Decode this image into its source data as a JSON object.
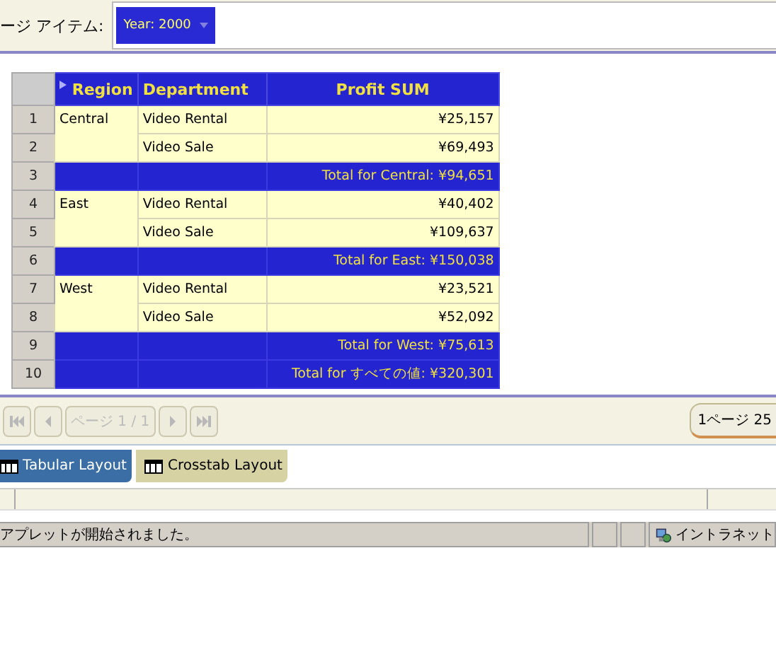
{
  "page_items": {
    "label": "ージ アイテム:",
    "chip": "Year: 2000"
  },
  "table": {
    "columns": [
      "",
      "Region",
      "Department",
      "Profit SUM"
    ],
    "rows": [
      {
        "kind": "data",
        "number": "1",
        "region": "Central",
        "department": "Video Rental",
        "profit": "¥25,157"
      },
      {
        "kind": "data",
        "number": "2",
        "department": "Video Sale",
        "profit": "¥69,493"
      },
      {
        "kind": "total",
        "number": "3",
        "profit": "Total for Central: ¥94,651"
      },
      {
        "kind": "data",
        "number": "4",
        "region": "East",
        "department": "Video Rental",
        "profit": "¥40,402"
      },
      {
        "kind": "data",
        "number": "5",
        "department": "Video Sale",
        "profit": "¥109,637"
      },
      {
        "kind": "total",
        "number": "6",
        "profit": "Total for East: ¥150,038"
      },
      {
        "kind": "data",
        "number": "7",
        "region": "West",
        "department": "Video Rental",
        "profit": "¥23,521"
      },
      {
        "kind": "data",
        "number": "8",
        "department": "Video Sale",
        "profit": "¥52,092"
      },
      {
        "kind": "total",
        "number": "9",
        "profit": "Total for West: ¥75,613"
      },
      {
        "kind": "total",
        "number": "10",
        "profit": "Total for すべての値: ¥320,301"
      }
    ]
  },
  "pager": {
    "page": "ページ 1 / 1",
    "rows_per_page": "1ページ 25"
  },
  "tabs": [
    {
      "label": "Tabular Layout",
      "selected": true
    },
    {
      "label": "Crosstab Layout",
      "selected": false
    }
  ],
  "status_bar": {
    "message": "アプレットが開始されました。",
    "zone": "イントラネット"
  }
}
